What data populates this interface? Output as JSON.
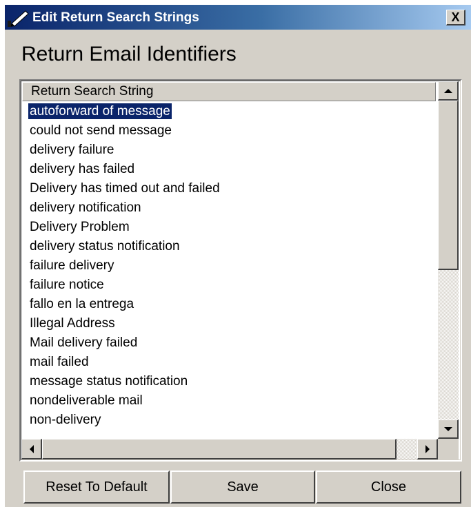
{
  "window": {
    "title": "Edit Return Search Strings",
    "close_label": "X",
    "icon": "edit-pencil-icon"
  },
  "heading": "Return Email Identifiers",
  "list": {
    "column_header": "Return Search String",
    "selected_index": 0,
    "items": [
      "autoforward of message",
      "could not send message",
      "delivery failure",
      "delivery has failed",
      "Delivery has timed out and failed",
      "delivery notification",
      "Delivery Problem",
      "delivery status notification",
      "failure delivery",
      "failure notice",
      "fallo en la entrega",
      "Illegal Address",
      "Mail delivery failed",
      "mail failed",
      "message status notification",
      "nondeliverable mail",
      "non-delivery"
    ]
  },
  "buttons": {
    "reset": "Reset To Default",
    "save": "Save",
    "close": "Close"
  },
  "colors": {
    "face": "#d4d0c8",
    "title_start": "#0a246a",
    "title_end": "#a6caf0",
    "selection": "#0a246a"
  }
}
